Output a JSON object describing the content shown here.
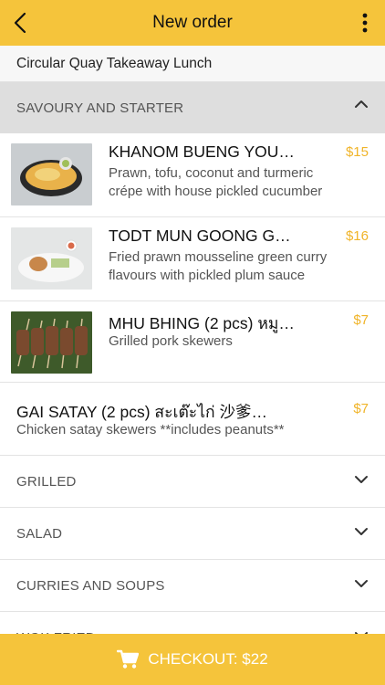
{
  "header": {
    "title": "New order",
    "back_icon": "chevron-left-icon",
    "menu_icon": "more-vertical-icon"
  },
  "subheader": {
    "label": "Circular Quay Takeaway Lunch"
  },
  "open_section": {
    "label": "SAVOURY AND STARTER",
    "icon": "chevron-up-icon"
  },
  "items": [
    {
      "name": "KHANOM BUENG YOU…",
      "desc": "Prawn, tofu, coconut and turmeric crépe with house pickled cucumber",
      "price": "$15"
    },
    {
      "name": "TODT MUN GOONG G…",
      "desc": "Fried prawn mousseline green curry flavours with pickled plum sauce",
      "price": "$16"
    },
    {
      "name": "MHU BHING (2 pcs) หมู…",
      "desc": "Grilled pork skewers",
      "price": "$7"
    },
    {
      "name": "GAI SATAY (2 pcs) สะเต๊ะไก่ 沙爹…",
      "desc": "Chicken satay skewers **includes peanuts**",
      "price": "$7"
    }
  ],
  "sections": [
    {
      "label": "GRILLED"
    },
    {
      "label": "SALAD"
    },
    {
      "label": "CURRIES AND SOUPS"
    },
    {
      "label": "WOK FRIED"
    }
  ],
  "checkout": {
    "label": "CHECKOUT: $22",
    "icon": "cart-icon"
  },
  "colors": {
    "accent": "#f5c43b",
    "price": "#f0b429"
  }
}
